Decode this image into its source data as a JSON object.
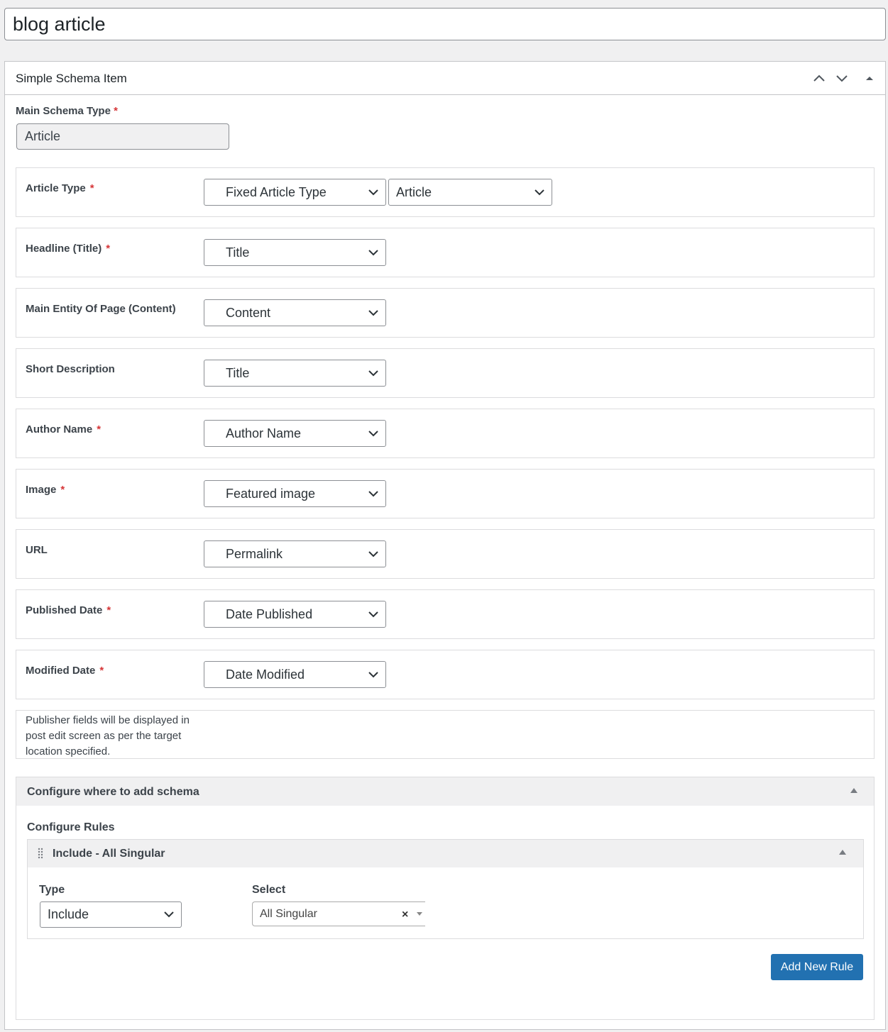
{
  "title_input": {
    "value": "blog article"
  },
  "panel": {
    "title": "Simple Schema Item",
    "main_schema_type": {
      "label": "Main Schema Type",
      "required": "*",
      "value": "Article"
    },
    "fields": [
      {
        "label": "Article Type",
        "required": "*",
        "selects": [
          "Fixed Article Type",
          "Article"
        ]
      },
      {
        "label": "Headline (Title)",
        "required": "*",
        "selects": [
          "Title"
        ]
      },
      {
        "label": "Main Entity Of Page (Content)",
        "required": "",
        "selects": [
          "Content"
        ]
      },
      {
        "label": "Short Description",
        "required": "",
        "selects": [
          "Title"
        ]
      },
      {
        "label": "Author Name",
        "required": "*",
        "selects": [
          "Author Name"
        ]
      },
      {
        "label": "Image",
        "required": "*",
        "selects": [
          "Featured image"
        ]
      },
      {
        "label": "URL",
        "required": "",
        "selects": [
          "Permalink"
        ]
      },
      {
        "label": "Published Date",
        "required": "*",
        "selects": [
          "Date Published"
        ]
      },
      {
        "label": "Modified Date",
        "required": "*",
        "selects": [
          "Date Modified"
        ]
      }
    ],
    "publisher_note": "Publisher fields will be displayed in post edit screen as per the target location specified."
  },
  "config": {
    "title": "Configure where to add schema",
    "rules_label": "Configure Rules",
    "rule": {
      "title": "Include - All Singular",
      "type_label": "Type",
      "type_value": "Include",
      "select_label": "Select",
      "select_value": "All Singular",
      "clear_symbol": "×"
    },
    "add_button": "Add New Rule"
  },
  "colors": {
    "primary_button": "#2271b1",
    "required": "#d63638"
  }
}
